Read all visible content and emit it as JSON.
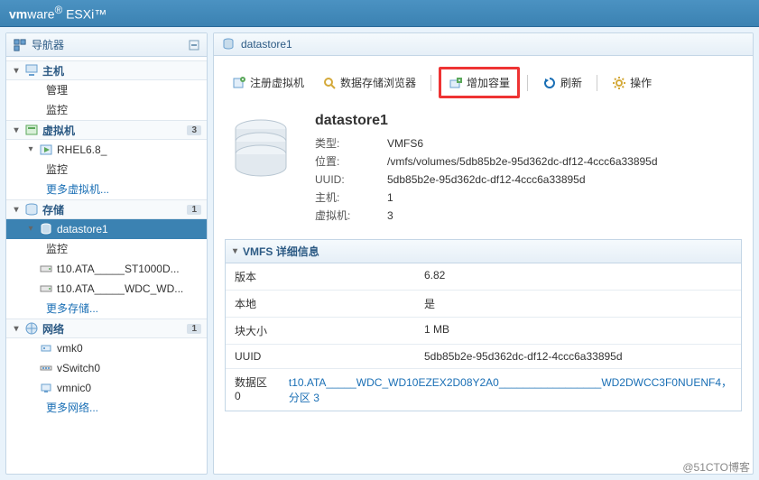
{
  "brand": {
    "vm": "vm",
    "ware": "ware",
    "product": "ESXi"
  },
  "navigator": {
    "title": "导航器",
    "host": {
      "label": "主机",
      "children": [
        "管理",
        "监控"
      ]
    },
    "vm": {
      "label": "虚拟机",
      "count": "3",
      "items": [
        {
          "label": "RHEL6.8_",
          "children": [
            "监控"
          ]
        }
      ],
      "more": "更多虚拟机..."
    },
    "storage": {
      "label": "存储",
      "count": "1",
      "items": [
        {
          "label": "datastore1",
          "selected": true,
          "children": [
            "监控"
          ]
        },
        {
          "label": "t10.ATA_____ST1000D..."
        },
        {
          "label": "t10.ATA_____WDC_WD..."
        }
      ],
      "more": "更多存储..."
    },
    "network": {
      "label": "网络",
      "count": "1",
      "items": [
        {
          "label": "vmk0"
        },
        {
          "label": "vSwitch0"
        },
        {
          "label": "vmnic0"
        }
      ],
      "more": "更多网络..."
    }
  },
  "page": {
    "title": "datastore1",
    "toolbar": {
      "register_vm": "注册虚拟机",
      "browser": "数据存储浏览器",
      "increase": "增加容量",
      "refresh": "刷新",
      "actions": "操作"
    },
    "summary": {
      "name": "datastore1",
      "rows": {
        "type": {
          "k": "类型:",
          "v": "VMFS6"
        },
        "location": {
          "k": "位置:",
          "v": "/vmfs/volumes/5db85b2e-95d362dc-df12-4ccc6a33895d"
        },
        "uuid": {
          "k": "UUID:",
          "v": "5db85b2e-95d362dc-df12-4ccc6a33895d"
        },
        "hosts": {
          "k": "主机:",
          "v": "1"
        },
        "vms": {
          "k": "虚拟机:",
          "v": "3"
        }
      }
    },
    "details": {
      "title": "VMFS 详细信息",
      "rows": {
        "version": {
          "k": "版本",
          "v": "6.82"
        },
        "local": {
          "k": "本地",
          "v": "是"
        },
        "block": {
          "k": "块大小",
          "v": "1 MB"
        },
        "uuid": {
          "k": "UUID",
          "v": "5db85b2e-95d362dc-df12-4ccc6a33895d"
        },
        "extent": {
          "k": "数据区 0",
          "v": "t10.ATA_____WDC_WD10EZEX2D08Y2A0_________________WD2DWCC3F0NUENF4，分区 3"
        }
      }
    }
  },
  "watermark": "@51CTO博客"
}
